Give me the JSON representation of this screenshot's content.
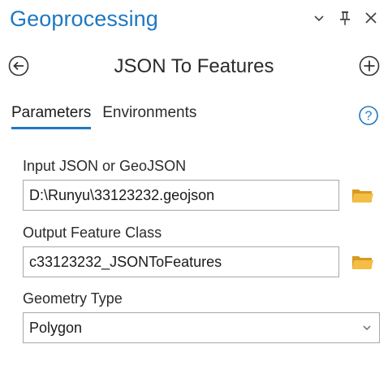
{
  "pane": {
    "title": "Geoprocessing"
  },
  "tool": {
    "name": "JSON To Features"
  },
  "tabs": [
    {
      "label": "Parameters",
      "active": true
    },
    {
      "label": "Environments",
      "active": false
    }
  ],
  "parameters": {
    "input_json": {
      "label": "Input JSON or GeoJSON",
      "value": "D:\\Runyu\\33123232.geojson"
    },
    "output_feature_class": {
      "label": "Output Feature Class",
      "value": "c33123232_JSONToFeatures"
    },
    "geometry_type": {
      "label": "Geometry Type",
      "value": "Polygon"
    }
  },
  "icons": {
    "back": "arrow-left-circle-icon",
    "add": "plus-circle-icon",
    "help": "question-circle-icon",
    "browse": "folder-icon",
    "dropdown": "chevron-down-icon",
    "pin": "pin-icon",
    "close": "close-icon",
    "options": "chevron-down-icon"
  },
  "colors": {
    "accent": "#1f78c1",
    "help": "#1f78c1",
    "folder": "#f0b63a",
    "border": "#a8a8a8"
  }
}
